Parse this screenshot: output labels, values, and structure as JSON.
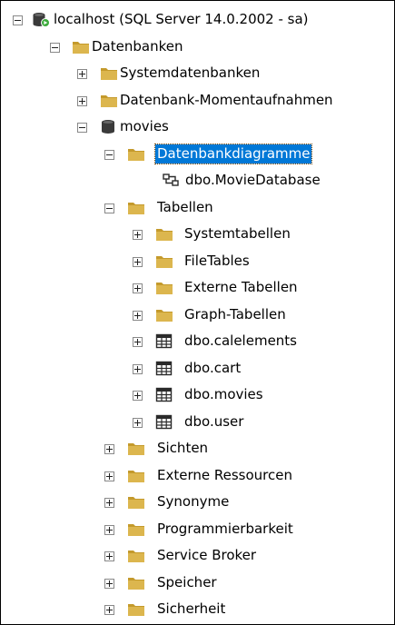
{
  "tree": {
    "server": {
      "label": "localhost (SQL Server 14.0.2002 - sa)",
      "icon": "server-icon"
    },
    "databases": {
      "label": "Datenbanken",
      "icon": "folder-icon"
    },
    "system_databases": {
      "label": "Systemdatenbanken",
      "icon": "folder-icon"
    },
    "snapshots": {
      "label": "Datenbank-Momentaufnahmen",
      "icon": "folder-icon"
    },
    "movies_db": {
      "label": "movies",
      "icon": "database-icon"
    },
    "diagrams": {
      "label": "Datenbankdiagramme",
      "icon": "folder-icon",
      "selected": true
    },
    "diagram_item": {
      "label": "dbo.MovieDatabase",
      "icon": "diagram-icon"
    },
    "tables": {
      "label": "Tabellen",
      "icon": "folder-icon"
    },
    "system_tables": {
      "label": "Systemtabellen",
      "icon": "folder-icon"
    },
    "file_tables": {
      "label": "FileTables",
      "icon": "folder-icon"
    },
    "external_tables": {
      "label": "Externe Tabellen",
      "icon": "folder-icon"
    },
    "graph_tables": {
      "label": "Graph-Tabellen",
      "icon": "folder-icon"
    },
    "table_calelements": {
      "label": "dbo.calelements",
      "icon": "table-icon"
    },
    "table_cart": {
      "label": "dbo.cart",
      "icon": "table-icon"
    },
    "table_movies": {
      "label": "dbo.movies",
      "icon": "table-icon"
    },
    "table_user": {
      "label": "dbo.user",
      "icon": "table-icon"
    },
    "views": {
      "label": "Sichten",
      "icon": "folder-icon"
    },
    "external_resources": {
      "label": "Externe Ressourcen",
      "icon": "folder-icon"
    },
    "synonyms": {
      "label": "Synonyme",
      "icon": "folder-icon"
    },
    "programmability": {
      "label": "Programmierbarkeit",
      "icon": "folder-icon"
    },
    "service_broker": {
      "label": "Service Broker",
      "icon": "folder-icon"
    },
    "storage": {
      "label": "Speicher",
      "icon": "folder-icon"
    },
    "security": {
      "label": "Sicherheit",
      "icon": "folder-icon"
    }
  },
  "colors": {
    "folder": "#dcb64e",
    "folder_dark": "#c49a2c",
    "selection": "#0078d7",
    "server_badge": "#3cab3c"
  }
}
